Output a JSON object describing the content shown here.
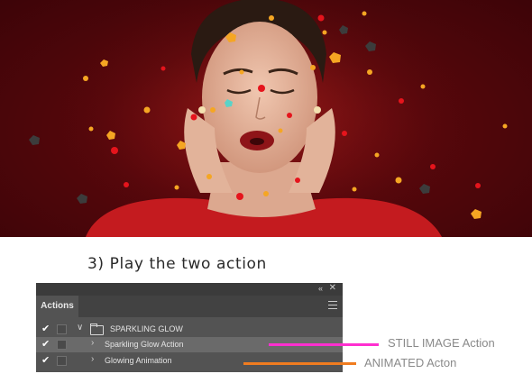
{
  "step_caption": "3)  Play the two action",
  "panel": {
    "tab_label": "Actions",
    "collapse_glyph": "«",
    "close_glyph": "✕",
    "rows": [
      {
        "check": "✔",
        "expand": "∨",
        "label": "SPARKLING GLOW",
        "icon": "folder-icon"
      },
      {
        "check": "✔",
        "expand": "›",
        "label": "Sparkling Glow Action",
        "selected": true
      },
      {
        "check": "✔",
        "expand": "›",
        "label": "Glowing Animation"
      }
    ]
  },
  "annotations": {
    "still": {
      "label": "STILL IMAGE Action",
      "color": "#ff2fd0"
    },
    "animated": {
      "label": "ANIMATED Acton",
      "color": "#f07c1f"
    }
  },
  "colors": {
    "background_red": "#55070b",
    "panel": "#535353",
    "sparkle_gold": "#f5a623",
    "sparkle_red": "#e5141c"
  }
}
